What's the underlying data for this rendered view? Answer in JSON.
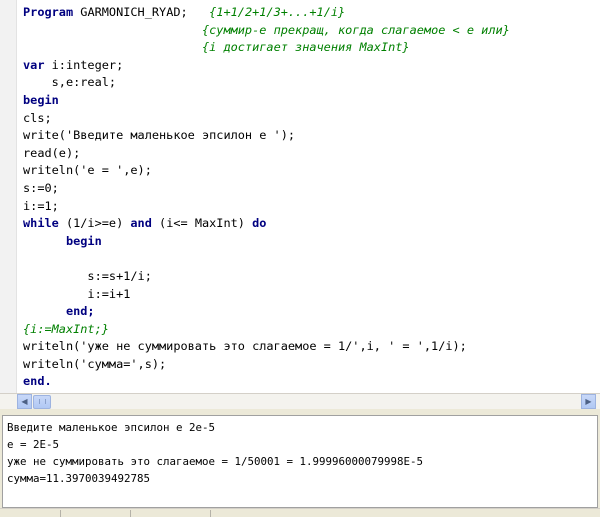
{
  "editor": {
    "lines": [
      [
        {
          "t": "kw",
          "v": "Program"
        },
        {
          "t": "tx",
          "v": " GARMONICH_RYAD;   "
        },
        {
          "t": "cm",
          "v": "{1+1/2+1/3+...+1/i}"
        }
      ],
      [
        {
          "t": "tx",
          "v": "                         "
        },
        {
          "t": "cm",
          "v": "{суммир-е прекращ, когда слагаемое < e или}"
        }
      ],
      [
        {
          "t": "tx",
          "v": "                         "
        },
        {
          "t": "cm",
          "v": "{i достигает значения MaxInt}"
        }
      ],
      [
        {
          "t": "kw",
          "v": "var"
        },
        {
          "t": "tx",
          "v": " i:integer;"
        }
      ],
      [
        {
          "t": "tx",
          "v": "    s,e:real;"
        }
      ],
      [
        {
          "t": "kw",
          "v": "begin"
        }
      ],
      [
        {
          "t": "tx",
          "v": "cls;"
        }
      ],
      [
        {
          "t": "tx",
          "v": "write('Введите маленькое эпсилон e ');"
        }
      ],
      [
        {
          "t": "tx",
          "v": "read(e);"
        }
      ],
      [
        {
          "t": "tx",
          "v": "writeln('e = ',e);"
        }
      ],
      [
        {
          "t": "tx",
          "v": "s:=0;"
        }
      ],
      [
        {
          "t": "tx",
          "v": "i:=1;"
        }
      ],
      [
        {
          "t": "kw",
          "v": "while"
        },
        {
          "t": "tx",
          "v": " (1/i>=e) "
        },
        {
          "t": "kw",
          "v": "and"
        },
        {
          "t": "tx",
          "v": " (i<= MaxInt) "
        },
        {
          "t": "kw",
          "v": "do"
        }
      ],
      [
        {
          "t": "tx",
          "v": "      "
        },
        {
          "t": "kw",
          "v": "begin"
        }
      ],
      [
        {
          "t": "tx",
          "v": ""
        }
      ],
      [
        {
          "t": "tx",
          "v": "         s:=s+1/i;"
        }
      ],
      [
        {
          "t": "tx",
          "v": "         i:=i+1"
        }
      ],
      [
        {
          "t": "tx",
          "v": "      "
        },
        {
          "t": "kw",
          "v": "end;"
        }
      ],
      [
        {
          "t": "cm",
          "v": "{i:=MaxInt;}"
        }
      ],
      [
        {
          "t": "tx",
          "v": "writeln('уже не суммировать это слагаемое = 1/',i, ' = ',1/i);"
        }
      ],
      [
        {
          "t": "tx",
          "v": "writeln('сумма=',s);"
        }
      ],
      [
        {
          "t": "kw",
          "v": "end."
        }
      ]
    ]
  },
  "output": {
    "lines": [
      "Введите маленькое эпсилон e 2e-5",
      "e = 2E-5",
      "уже не суммировать это слагаемое = 1/50001 = 1.99996000079998E-5",
      "сумма=11.3970039492785"
    ]
  },
  "scrollbar": {
    "left_arrow": "◀",
    "right_arrow": "▶"
  },
  "colors": {
    "keyword": "#000080",
    "comment": "#008000",
    "text": "#000000",
    "background": "#ffffff"
  }
}
